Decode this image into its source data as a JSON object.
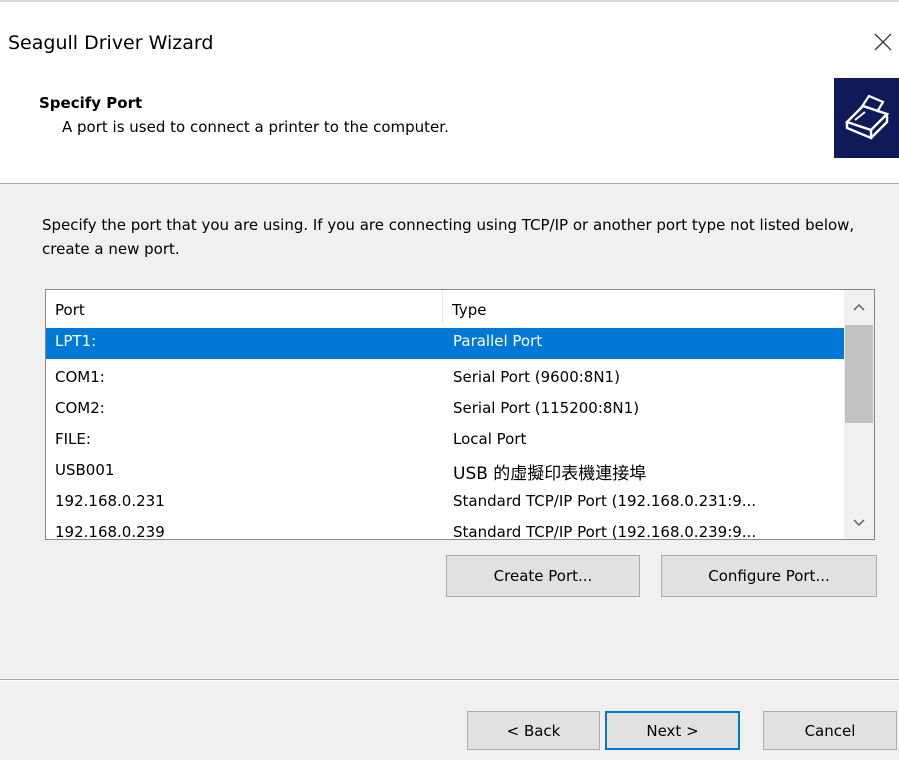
{
  "window": {
    "title": "Seagull Driver Wizard",
    "close_icon": "close-icon"
  },
  "header": {
    "title": "Specify Port",
    "subtitle": "A port is used to connect a printer to the computer.",
    "logo_icon": "printer-icon",
    "logo_color": "#101a5b"
  },
  "body": {
    "description": "Specify the port that you are using.  If you are connecting using TCP/IP or another port type not listed below, create a new port."
  },
  "port_list": {
    "columns": [
      "Port",
      "Type"
    ],
    "rows": [
      {
        "port": "LPT1:",
        "type": "Parallel Port",
        "selected": true
      },
      {
        "port": "COM1:",
        "type": "Serial Port (9600:8N1)",
        "selected": false
      },
      {
        "port": "COM2:",
        "type": "Serial Port (115200:8N1)",
        "selected": false
      },
      {
        "port": "FILE:",
        "type": "Local Port",
        "selected": false
      },
      {
        "port": "USB001",
        "type": "USB 的虛擬印表機連接埠",
        "selected": false
      },
      {
        "port": "192.168.0.231",
        "type": "Standard TCP/IP Port (192.168.0.231:9...",
        "selected": false
      },
      {
        "port": "192.168.0.239",
        "type": "Standard TCP/IP Port (192.168.0.239:9...",
        "selected": false
      }
    ],
    "selection_color": "#0078d7",
    "scroll_up_icon": "chevron-up-icon",
    "scroll_down_icon": "chevron-down-icon"
  },
  "actions": {
    "create_port": "Create Port...",
    "configure_port": "Configure Port..."
  },
  "footer": {
    "back": "< Back",
    "next": "Next >",
    "cancel": "Cancel"
  }
}
